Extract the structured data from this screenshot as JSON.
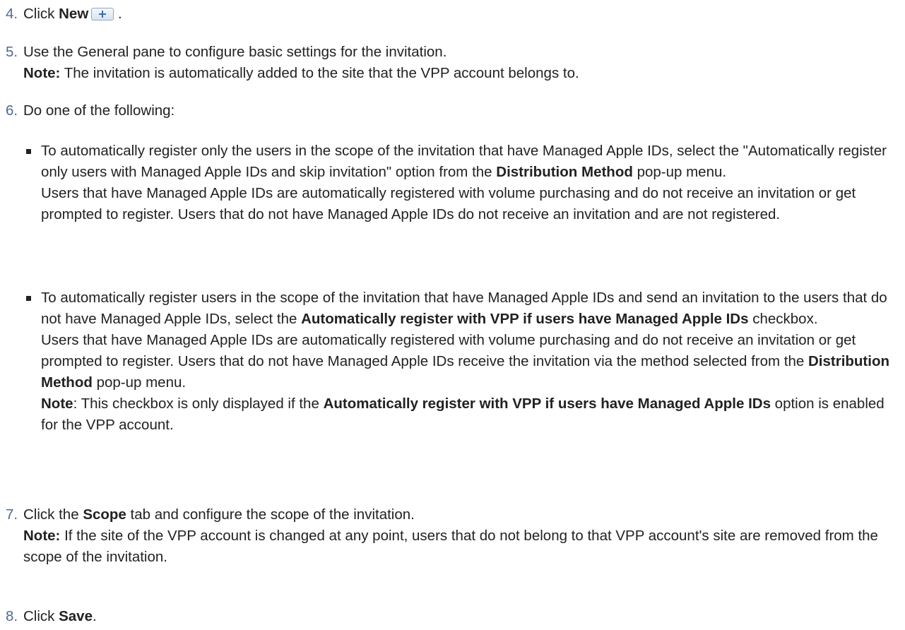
{
  "steps": [
    {
      "num": "4.",
      "pre": "Click ",
      "bold": "New",
      "post": " ."
    },
    {
      "num": "5.",
      "text": "Use the General pane to configure basic settings for the invitation.",
      "note_label": "Note:",
      "note_text": " The invitation is automatically added to the site that the VPP account belongs to."
    },
    {
      "num": "6.",
      "text": "Do one of the following:",
      "bullets": [
        {
          "a": "To automatically register only the users in the scope of the invitation that have Managed Apple IDs, select the \"Automatically register only users with Managed Apple IDs and skip invitation\" option from the ",
          "b": "Distribution Method",
          "c": " pop-up menu.",
          "d": "Users that have Managed Apple IDs are automatically registered with volume purchasing and do not receive an invitation or get prompted to register. Users that do not have Managed Apple IDs do not receive an invitation and are not registered."
        },
        {
          "a": "To automatically register users in the scope of the invitation that have Managed Apple IDs and send an invitation to the users that do not have Managed Apple IDs, select the ",
          "b": "Automatically register with VPP if users have Managed Apple IDs",
          "c": " checkbox.",
          "d1": "Users that have Managed Apple IDs are automatically registered with volume purchasing and do not receive an invitation or get prompted to register. Users that do not have Managed Apple IDs receive the invitation via the method selected from the ",
          "d2": "Distribution Method",
          "d3": " pop-up menu.",
          "note_label": "Note",
          "note_a": ": This checkbox is only displayed if the ",
          "note_b": "Automatically register with VPP if users have Managed Apple IDs",
          "note_c": " option is enabled for the VPP account."
        }
      ]
    },
    {
      "num": "7.",
      "pre": "Click the ",
      "bold": "Scope",
      "post": " tab and configure the scope of the invitation.",
      "note_label": "Note:",
      "note_text": " If the site of the VPP account is changed at any point, users that do not belong to that VPP account's site are removed from the scope of the invitation."
    },
    {
      "num": "8.",
      "pre": "Click ",
      "bold": "Save",
      "post": "."
    }
  ],
  "icons": {
    "new_button_icon": "plus-icon"
  }
}
